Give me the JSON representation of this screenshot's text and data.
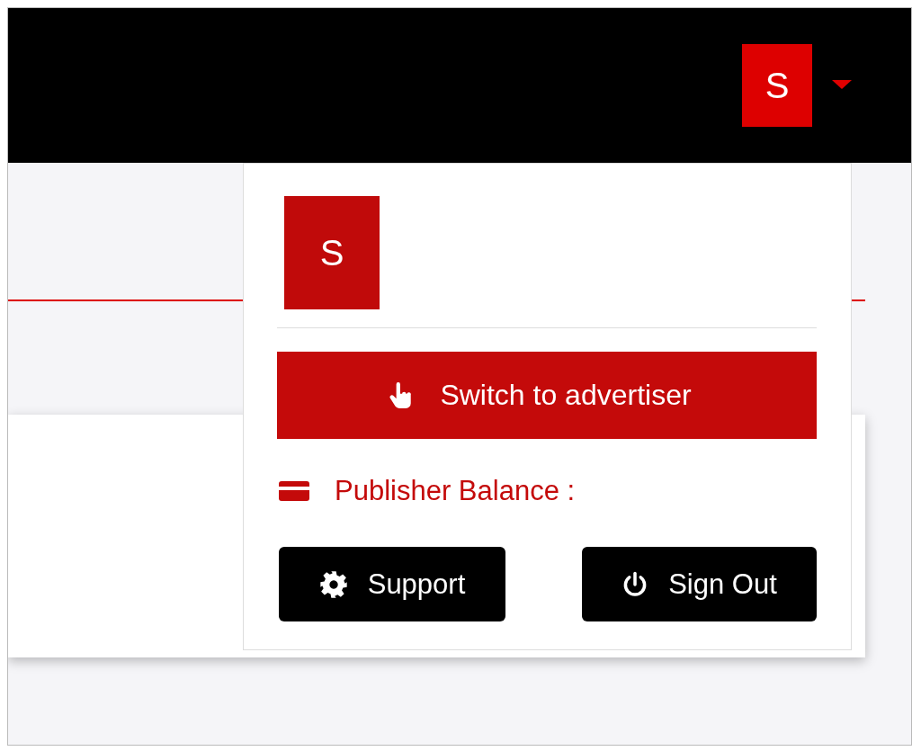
{
  "header": {
    "avatar_letter": "S",
    "expanded": true
  },
  "dropdown": {
    "avatar_letter": "S",
    "switch_button": "Switch to advertiser",
    "balance_label": "Publisher Balance :",
    "buttons": [
      {
        "label": "Support",
        "kind": "support"
      },
      {
        "label": "Sign Out",
        "kind": "signout"
      }
    ]
  }
}
